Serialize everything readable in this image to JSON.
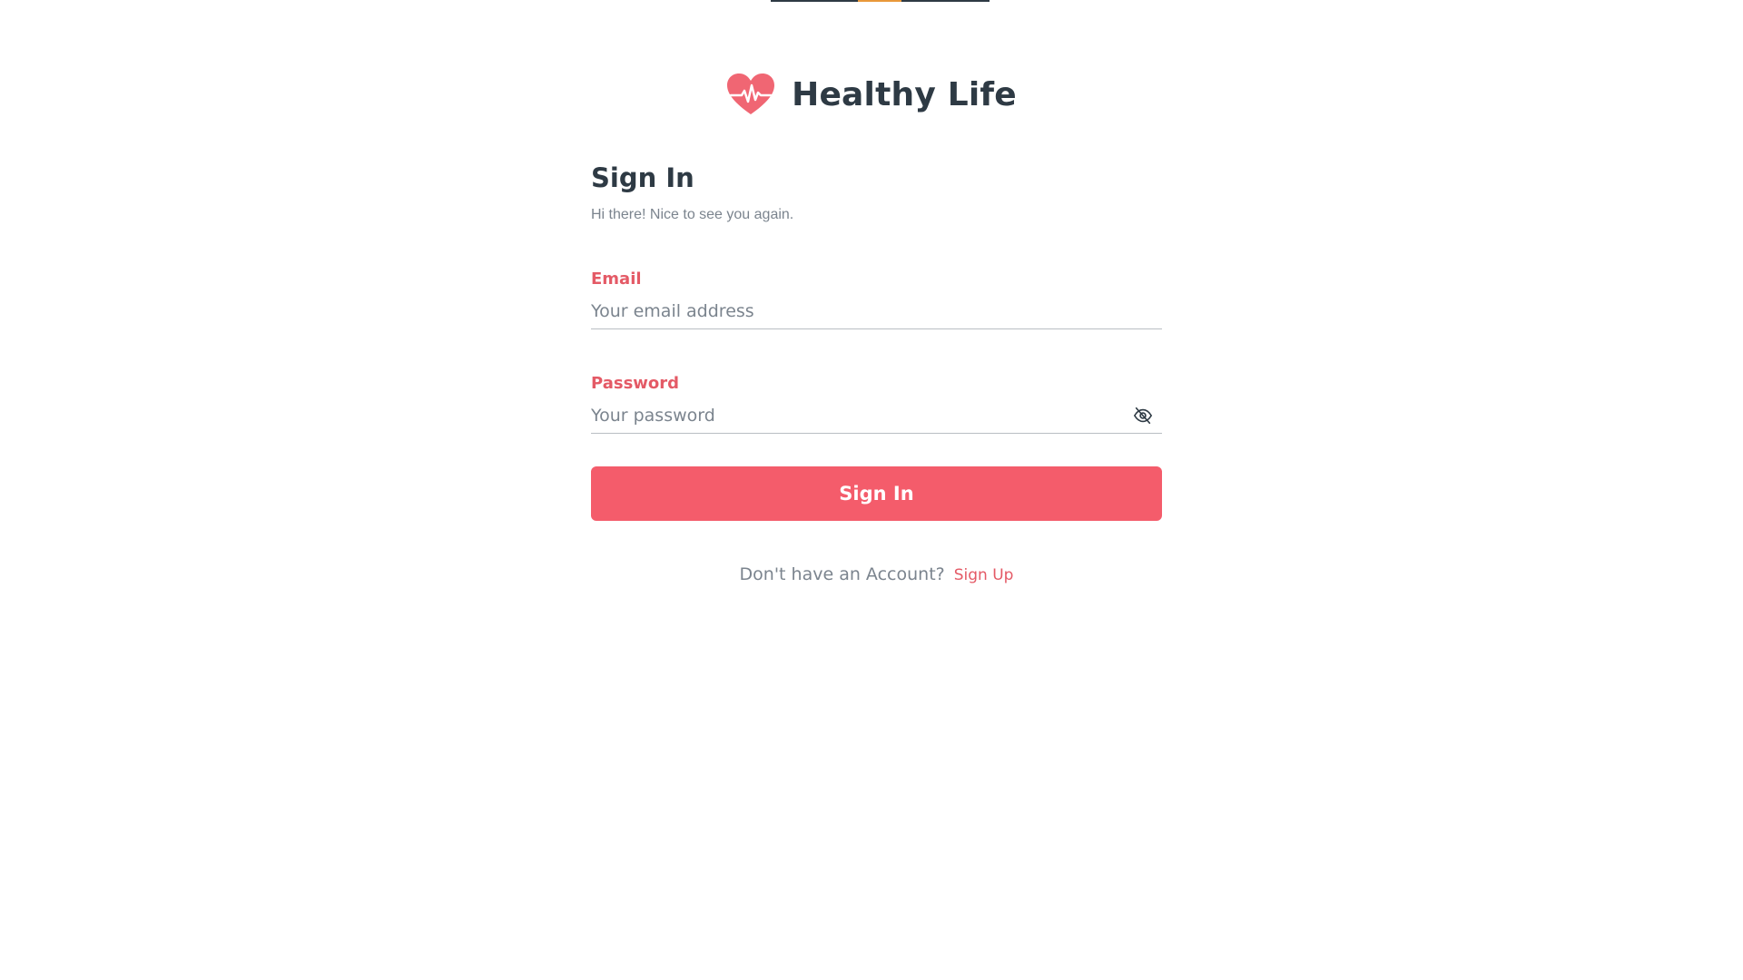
{
  "app": {
    "name": "Healthy Life",
    "logo_icon": "heartbeat-heart-icon"
  },
  "top_indicator": {
    "colors": {
      "track": "#2e3a44",
      "active": "#e8983a"
    }
  },
  "form": {
    "title": "Sign In",
    "subtitle": "Hi there! Nice to see you again.",
    "email": {
      "label": "Email",
      "value": "",
      "placeholder": "Your email address"
    },
    "password": {
      "label": "Password",
      "value": "",
      "placeholder": "Your password",
      "toggle_icon": "eye-off-icon"
    },
    "submit_label": "Sign In"
  },
  "footer": {
    "prompt": "Don't have an Account?",
    "link_label": "Sign Up"
  },
  "colors": {
    "accent": "#f45c6b",
    "label": "#e45a66",
    "heading": "#2e3a44",
    "muted": "#7b848e"
  }
}
